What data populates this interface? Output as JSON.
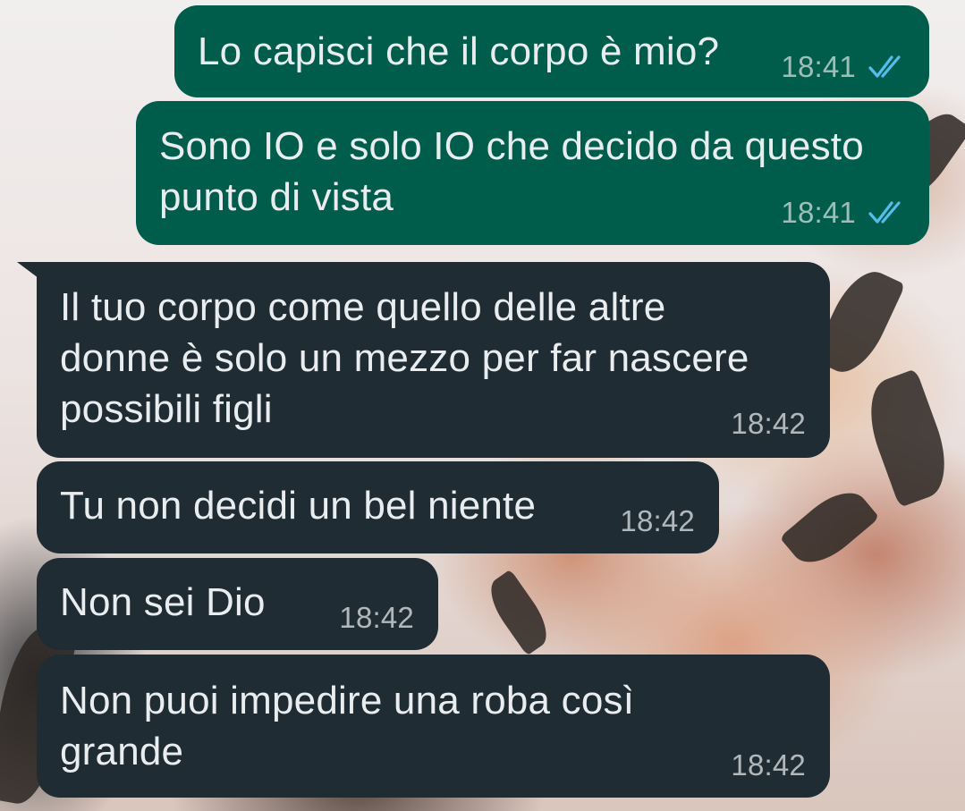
{
  "conversation": {
    "messages": [
      {
        "direction": "outgoing",
        "text": "Lo capisci che il corpo è mio?",
        "time": "18:41",
        "status": "read",
        "status_icon": "double-check-icon"
      },
      {
        "direction": "outgoing",
        "text": "Sono IO e solo IO che decido da questo\npunto di vista",
        "time": "18:41",
        "status": "read",
        "status_icon": "double-check-icon"
      },
      {
        "direction": "incoming",
        "text": "Il tuo corpo come quello delle altre\ndonne è solo un mezzo per far nascere\npossibili figli",
        "time": "18:42"
      },
      {
        "direction": "incoming",
        "text": "Tu non decidi un bel niente",
        "time": "18:42"
      },
      {
        "direction": "incoming",
        "text": "Non sei Dio",
        "time": "18:42"
      },
      {
        "direction": "incoming",
        "text": "Non puoi impedire una roba così\ngrande",
        "time": "18:42"
      }
    ]
  },
  "colors": {
    "outgoing_bubble": "#005c4b",
    "incoming_bubble": "#202c33",
    "message_text": "#e9edef",
    "read_ticks": "#53bdeb"
  }
}
